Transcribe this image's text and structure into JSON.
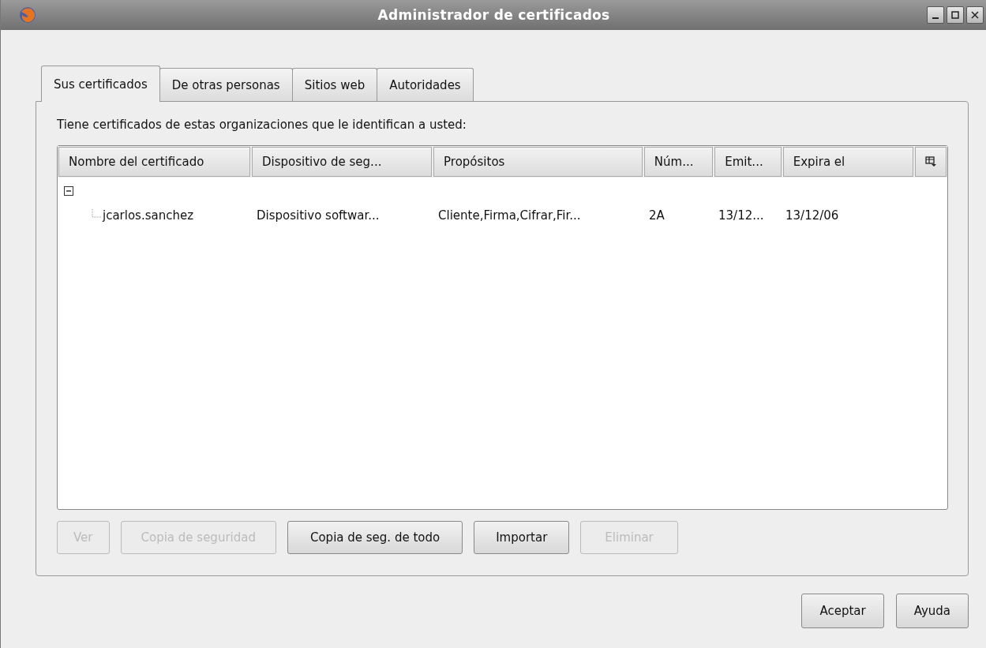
{
  "window": {
    "title": "Administrador de certificados"
  },
  "tabs": [
    {
      "label": "Sus certificados",
      "selected": true
    },
    {
      "label": "De otras personas",
      "selected": false
    },
    {
      "label": "Sitios web",
      "selected": false
    },
    {
      "label": "Autoridades",
      "selected": false
    }
  ],
  "description": "Tiene certificados de estas organizaciones que le identifican a usted:",
  "table": {
    "columns": [
      "Nombre del certificado",
      "Dispositivo de seg...",
      "Propósitos",
      "Núm...",
      "Emit...",
      "Expira el"
    ],
    "rows": [
      {
        "expanded": true,
        "children": [
          {
            "cells": [
              "jcarlos.sanchez",
              "Dispositivo softwar...",
              "Cliente,Firma,Cifrar,Fir...",
              "2A",
              "13/12...",
              "13/12/06"
            ]
          }
        ]
      }
    ]
  },
  "actions": [
    {
      "label": "Ver",
      "disabled": true
    },
    {
      "label": "Copia de seguridad",
      "disabled": true
    },
    {
      "label": "Copia de seg. de todo",
      "disabled": false
    },
    {
      "label": "Importar",
      "disabled": false
    },
    {
      "label": "Eliminar",
      "disabled": true
    }
  ],
  "dialog_buttons": [
    {
      "label": "Aceptar"
    },
    {
      "label": "Ayuda"
    }
  ]
}
